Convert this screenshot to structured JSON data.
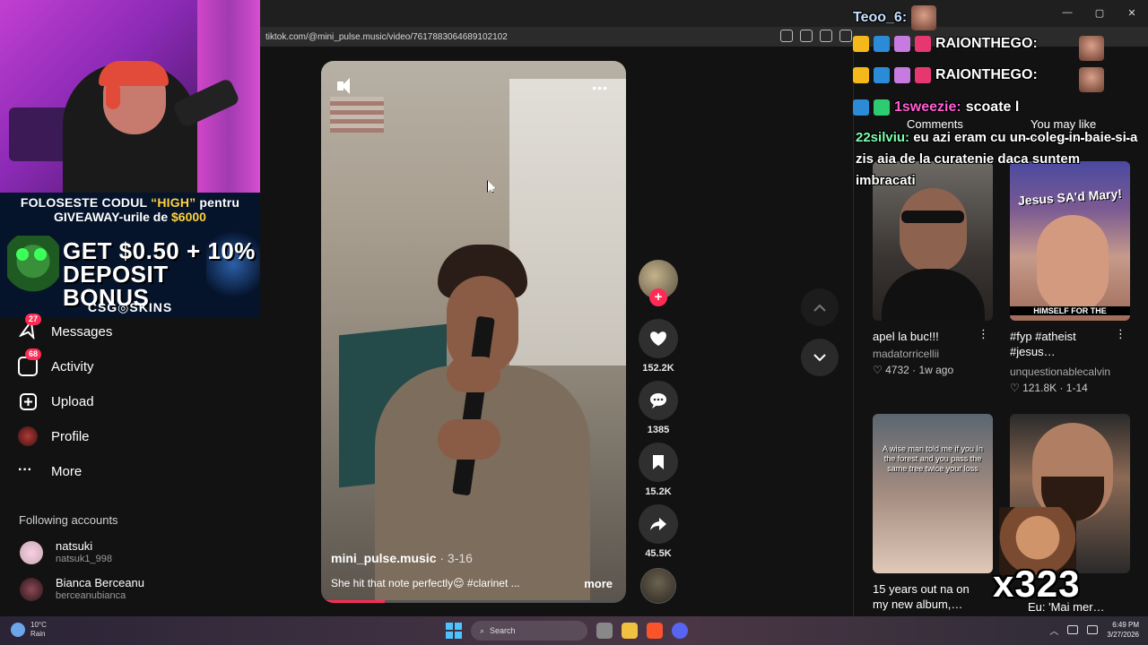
{
  "browser": {
    "url": "tiktok.com/@mini_pulse.music/video/7617883064689102102",
    "window_controls": [
      "—",
      "▢",
      "✕"
    ]
  },
  "promo": {
    "line1_prefix": "FOLOSESTE CODUL ",
    "line1_code": "“HIGH”",
    "line1_suffix": " pentru",
    "line2_prefix": "GIVEAWAY-urile de ",
    "line2_amount": "$6000",
    "big_line1": "GET $0.50 + 10%",
    "big_line2": "DEPOSIT BONUS",
    "brand": "CSG◎SKINS"
  },
  "sidebar": {
    "items": [
      {
        "label": "Messages",
        "badge": "27",
        "icon": "paper-plane-icon"
      },
      {
        "label": "Activity",
        "badge": "68",
        "icon": "inbox-icon"
      },
      {
        "label": "Upload",
        "badge": "",
        "icon": "plus-square-icon"
      },
      {
        "label": "Profile",
        "badge": "",
        "icon": "profile-avatar-icon"
      },
      {
        "label": "More",
        "badge": "",
        "icon": "ellipsis-icon"
      }
    ],
    "following_title": "Following accounts",
    "accounts": [
      {
        "name": "natsuki",
        "handle": "natsuk1_998"
      },
      {
        "name": "Bianca Berceanu",
        "handle": "berceanubianca"
      }
    ]
  },
  "video": {
    "username": "mini_pulse.music",
    "date": " · 3-16",
    "caption": "She hit that note perfectly😌 #clarinet ...",
    "more_label": "more",
    "progress": 0.21,
    "more_dots": "•••"
  },
  "actions": {
    "likes": "152.2K",
    "comments": "1385",
    "saves": "15.2K",
    "shares": "45.5K",
    "plus": "+"
  },
  "right_panel": {
    "tab_comments": "Comments",
    "tab_like": "You may like",
    "cards": [
      {
        "title": "apel la buc!!!",
        "author": "madatorricellii",
        "likes": "♡ 4732 · 1w ago"
      },
      {
        "title": "#fyp #atheist #jesus…",
        "author": "unquestionablecalvin",
        "likes": "♡ 121.8K · 1-14",
        "overlay_top": "Jesus SA'd Mary!",
        "overlay_bottom": "HIMSELF FOR THE"
      },
      {
        "title": "15 years out na on my new album,…",
        "author": "",
        "likes": "",
        "overlay_top": "A wise man told me if you In the forest and you pass the same tree twice your loss"
      },
      {
        "title": "Eu: 'Mai mer…",
        "author": "",
        "likes": ""
      }
    ]
  },
  "chat": {
    "top_user": "Teoo_6:",
    "line_raion": "RAIONTHEGO:",
    "line3_user": "1sweezie:",
    "line3_msg": "scoate l",
    "line4_user": "22silviu:",
    "line4_msg": "eu azi eram cu un coleg in baie si a zis aia de la curatenie daca suntem imbracati",
    "multiplier": "x323"
  },
  "taskbar": {
    "temp": "10°C",
    "weather": "Rain",
    "search": "Search",
    "time": "6:49 PM",
    "date": "3/27/2026"
  },
  "colors": {
    "accent": "#fe2c55",
    "bg": "#121212",
    "promo_yellow": "#ffd23c"
  }
}
